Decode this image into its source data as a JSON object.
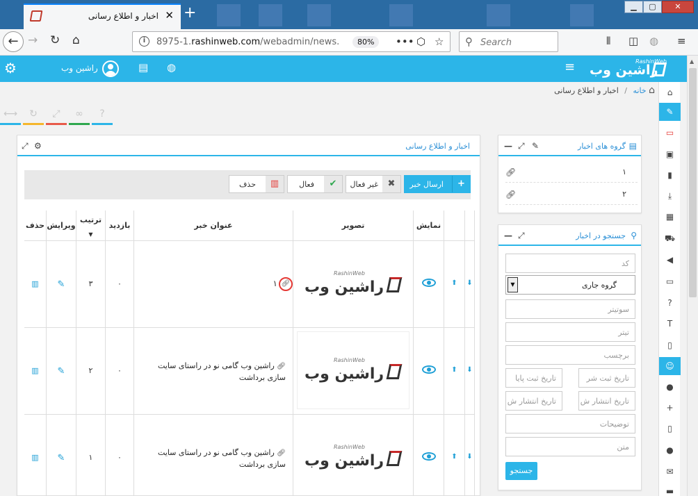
{
  "browser": {
    "tab_title": "اخبار و اطلاع رسانی",
    "url_prefix": "8975-1.",
    "url_domain": "rashinweb.com",
    "url_path": "/webadmin/news.",
    "zoom": "80%",
    "search_placeholder": "Search"
  },
  "header": {
    "username": "راشین وب",
    "brand_name": "راشین وب",
    "brand_en": "RashinWeb"
  },
  "breadcrumb": {
    "home": "خانه",
    "current": "اخبار و اطلاع رسانی"
  },
  "quick_colors": [
    "#2cb5e8",
    "#f5b62c",
    "#e85b4a",
    "#2fa84f",
    "#2cb5e8"
  ],
  "groups_panel": {
    "title": "گروه های اخبار",
    "items": [
      {
        "label": "۱"
      },
      {
        "label": "۲"
      }
    ]
  },
  "search_panel": {
    "title": "جستجو در اخبار",
    "code_ph": "کد",
    "group_value": "گروه جاری",
    "subtitle_ph": "سوتیتر",
    "titr_ph": "تیتر",
    "tag_ph": "برچسب",
    "reg_start_ph": "تاریخ ثبت شر",
    "reg_end_ph": "تاریخ ثبت پایا",
    "pub_start_ph": "تاریخ انتشار ش",
    "pub_end_ph": "تاریخ انتشار ش",
    "desc_ph": "توضیحات",
    "text_ph": "متن",
    "submit": "جستجو"
  },
  "main_panel": {
    "title": "اخبار و اطلاع رسانی",
    "actions": {
      "send": "ارسال خبر",
      "inactive": "غیر فعال",
      "active": "فعال",
      "delete": "حذف"
    },
    "columns": {
      "show": "نمایش",
      "image": "تصویر",
      "title": "عنوان خبر",
      "visits": "بازدید",
      "order": "ترتیب",
      "edit": "ویرایش",
      "delete": "حذف"
    },
    "logo_text": "راشین وب",
    "logo_en": "RashinWeb",
    "rows": [
      {
        "title": "۱",
        "visits": "۰",
        "order": "۳"
      },
      {
        "title": "راشین وب گامی نو در راستای سایت سازی برداشت",
        "visits": "۰",
        "order": "۲"
      },
      {
        "title": "راشین وب گامی نو در راستای سایت سازی برداشت",
        "visits": "۰",
        "order": "۱"
      }
    ]
  }
}
